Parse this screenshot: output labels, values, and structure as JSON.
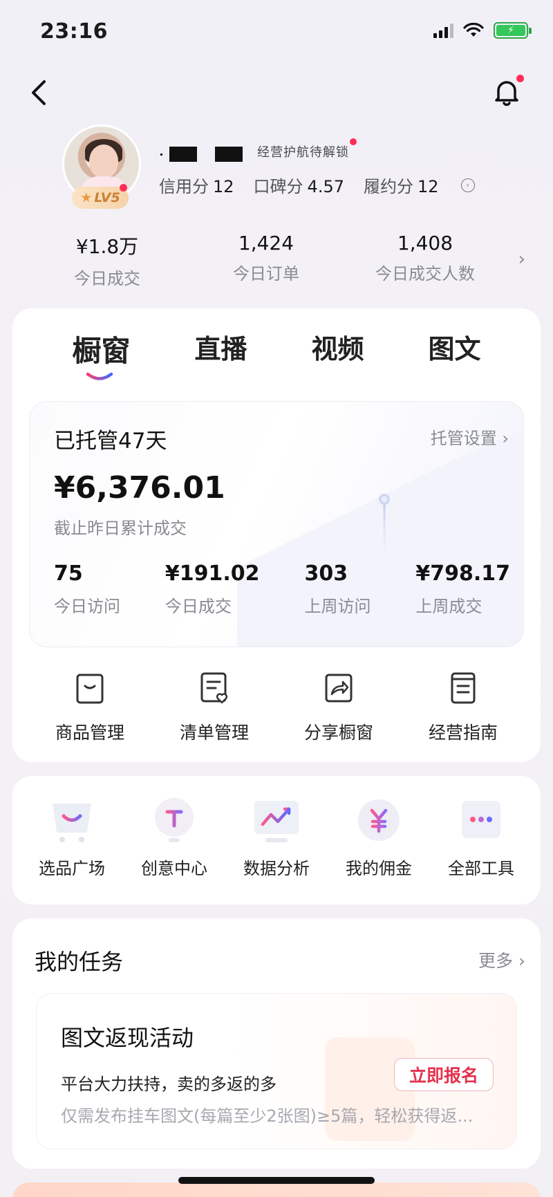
{
  "status_bar": {
    "time": "23:16"
  },
  "profile": {
    "level": "LV5",
    "guard_tag": "经营护航待解锁",
    "scores": [
      {
        "label": "信用分",
        "value": "12"
      },
      {
        "label": "口碑分",
        "value": "4.57"
      },
      {
        "label": "履约分",
        "value": "12"
      }
    ]
  },
  "today_stats": [
    {
      "value": "¥1.8万",
      "label": "今日成交"
    },
    {
      "value": "1,424",
      "label": "今日订单"
    },
    {
      "value": "1,408",
      "label": "今日成交人数"
    }
  ],
  "tabs": [
    "橱窗",
    "直播",
    "视频",
    "图文"
  ],
  "active_tab": "橱窗",
  "trust": {
    "title": "已托管47天",
    "setting": "托管设置 ›",
    "amount": "¥6,376.01",
    "amount_label": "截止昨日累计成交",
    "stats": [
      {
        "value": "75",
        "label": "今日访问"
      },
      {
        "value": "¥191.02",
        "label": "今日成交"
      },
      {
        "value": "303",
        "label": "上周访问"
      },
      {
        "value": "¥798.17",
        "label": "上周成交"
      }
    ]
  },
  "quick_actions": [
    {
      "label": "商品管理",
      "icon": "bag-icon"
    },
    {
      "label": "清单管理",
      "icon": "list-heart-icon"
    },
    {
      "label": "分享橱窗",
      "icon": "share-icon"
    },
    {
      "label": "经营指南",
      "icon": "guide-book-icon"
    }
  ],
  "tools": [
    {
      "label": "选品广场",
      "icon": "cart-icon"
    },
    {
      "label": "创意中心",
      "icon": "bulb-icon"
    },
    {
      "label": "数据分析",
      "icon": "chart-icon"
    },
    {
      "label": "我的佣金",
      "icon": "yen-coin-icon"
    },
    {
      "label": "全部工具",
      "icon": "more-dots-icon"
    }
  ],
  "tasks": {
    "title": "我的任务",
    "more": "更多",
    "item": {
      "title": "图文返现活动",
      "line1": "平台大力扶持，卖的多返的多",
      "line2": "仅需发布挂车图文(每篇至少2张图)≥5篇，轻松获得返...",
      "button": "立即报名"
    }
  },
  "colors": {
    "accent_red": "#e6304d",
    "badge_red": "#ff2d55",
    "battery_green": "#34c759"
  }
}
